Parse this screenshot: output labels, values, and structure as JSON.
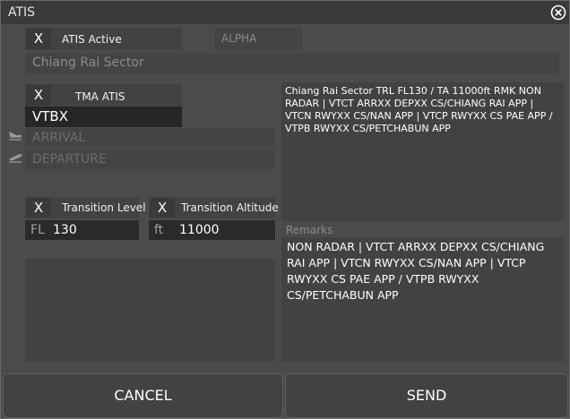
{
  "window": {
    "title": "ATIS"
  },
  "atis_active": {
    "checkbox": "X",
    "label": "ATIS Active"
  },
  "letter": "ALPHA",
  "sector_name": "Chiang Rai Sector",
  "tma": {
    "checkbox": "X",
    "label": "TMA ATIS",
    "airport": "VTBX",
    "arrival_placeholder": "ARRIVAL",
    "departure_placeholder": "DEPARTURE"
  },
  "transition_level": {
    "checkbox": "X",
    "label": "Transition Level",
    "unit": "FL",
    "value": "130"
  },
  "transition_altitude": {
    "checkbox": "X",
    "label": "Transition Altitude",
    "unit": "ft",
    "value": "11000"
  },
  "preview_text": "Chiang Rai Sector TRL FL130 / TA 11000ft RMK NON RADAR | VTCT ARRXX DEPXX CS/CHIANG RAI APP | VTCN RWYXX CS/NAN APP | VTCP RWYXX CS PAE APP / VTPB RWYXX CS/PETCHABUN APP",
  "remarks": {
    "label": "Remarks",
    "text": "NON RADAR | VTCT ARRXX DEPXX CS/CHIANG RAI APP | VTCN RWYXX CS/NAN APP | VTCP RWYXX CS PAE APP / VTPB RWYXX CS/PETCHABUN APP"
  },
  "buttons": {
    "cancel": "CANCEL",
    "send": "SEND"
  },
  "icons": {
    "close": "close-icon",
    "arrival": "plane-landing-icon",
    "departure": "plane-takeoff-icon"
  }
}
